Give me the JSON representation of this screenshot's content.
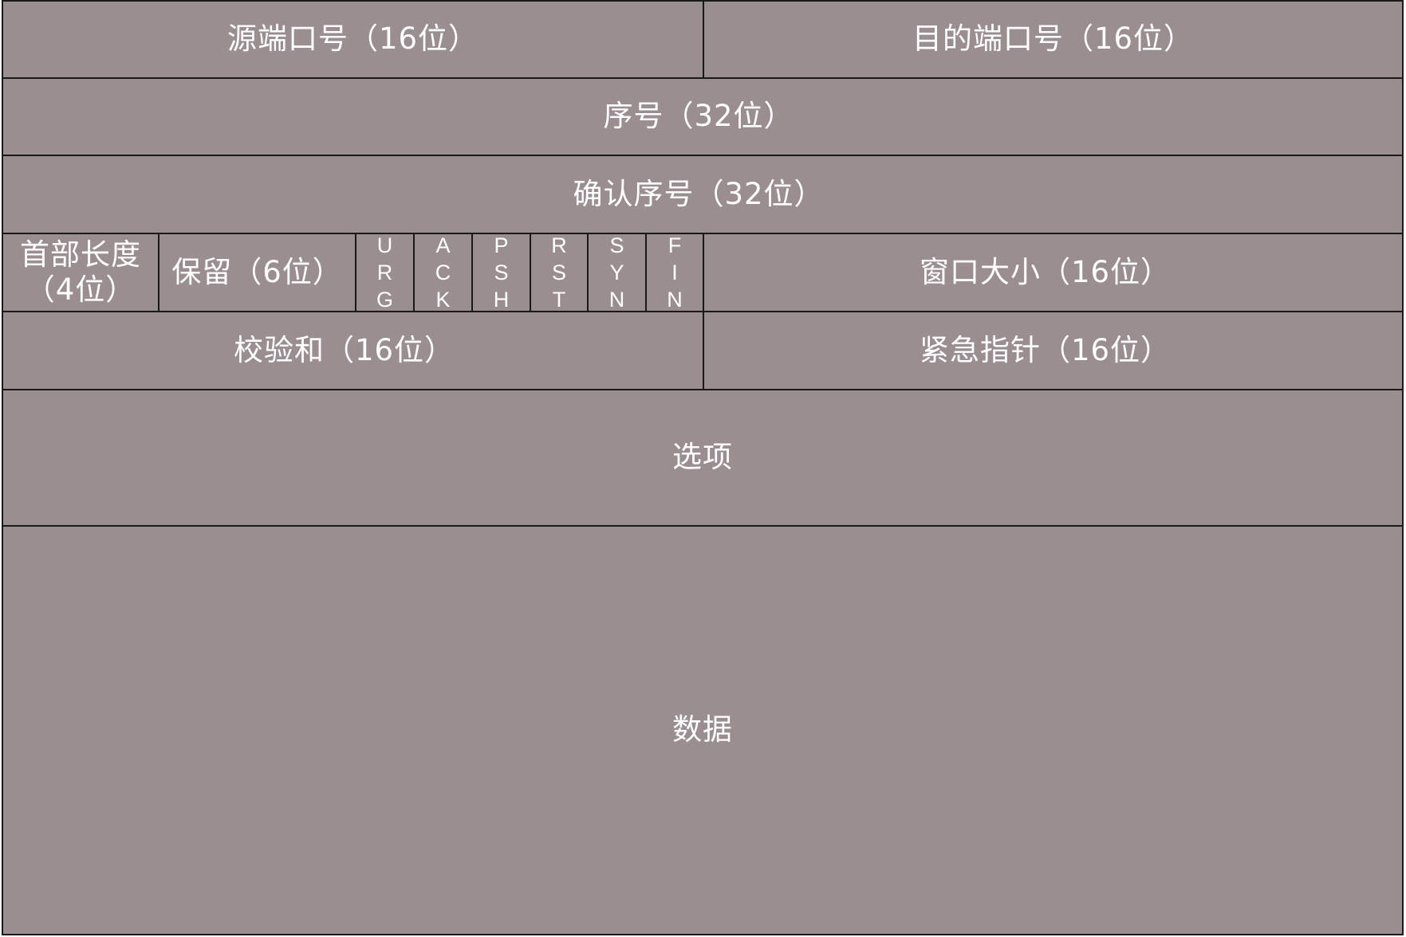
{
  "rows": {
    "row1": {
      "source_port": "源端口号（16位）",
      "dest_port": "目的端口号（16位）"
    },
    "row2": {
      "sequence_number": "序号（32位）"
    },
    "row3": {
      "ack_number": "确认序号（32位）"
    },
    "row4": {
      "header_length_line1": "首部长度",
      "header_length_line2": "（4位）",
      "reserved": "保留（6位）",
      "flags": [
        {
          "chars": [
            "U",
            "R",
            "G"
          ]
        },
        {
          "chars": [
            "A",
            "C",
            "K"
          ]
        },
        {
          "chars": [
            "P",
            "S",
            "H"
          ]
        },
        {
          "chars": [
            "R",
            "S",
            "T"
          ]
        },
        {
          "chars": [
            "S",
            "Y",
            "N"
          ]
        },
        {
          "chars": [
            "F",
            "I",
            "N"
          ]
        }
      ],
      "window_size": "窗口大小（16位）"
    },
    "row5": {
      "checksum": "校验和（16位）",
      "urgent_pointer": "紧急指针（16位）"
    },
    "row6": {
      "options": "选项"
    },
    "row7": {
      "data": "数据"
    }
  },
  "colors": {
    "fill": "#9a8e91",
    "border": "#1a1a1a",
    "text": "#ffffff"
  }
}
